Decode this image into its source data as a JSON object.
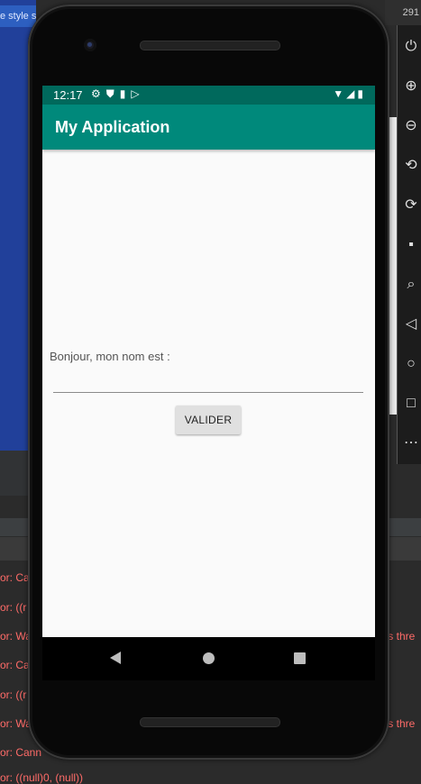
{
  "ide": {
    "top_strip_text": "e style s",
    "right_top_text": "291",
    "log_left": [
      "or: Ca",
      "or: ((r",
      "or: Wa",
      "or: Ca",
      "or: ((r",
      "or: Wa",
      "or: Cann",
      "or: ((null)0, (null))"
    ],
    "log_right": [
      "'s thre",
      "'s thre"
    ]
  },
  "statusbar": {
    "time": "12:17",
    "left_icons": [
      "gear-icon",
      "shield-icon",
      "sd-card-icon",
      "play-store-icon"
    ],
    "right_icons": [
      "wifi-icon",
      "signal-icon",
      "battery-icon"
    ]
  },
  "appbar": {
    "title": "My Application"
  },
  "form": {
    "label": "Bonjour, mon nom est :",
    "name_value": "",
    "name_placeholder": "",
    "submit_label": "VALIDER"
  },
  "navbar": {
    "buttons": [
      "back",
      "home",
      "recents"
    ]
  },
  "colors": {
    "statusbar": "#00695c",
    "appbar": "#00897b",
    "background": "#fafafa"
  }
}
